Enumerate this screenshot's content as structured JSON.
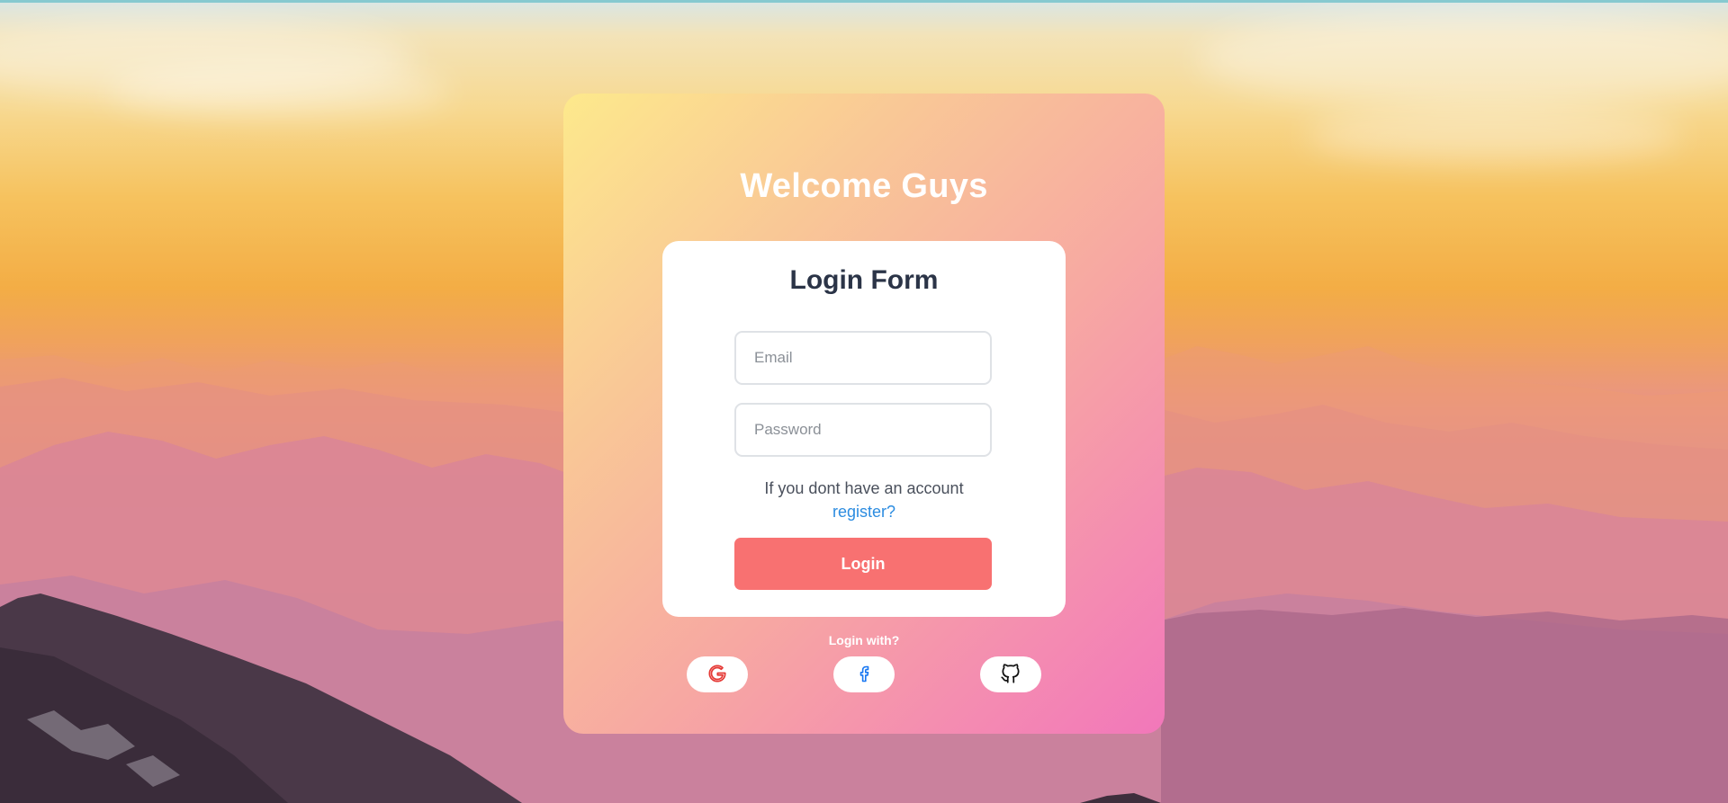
{
  "card": {
    "heading": "Welcome Guys"
  },
  "form": {
    "title": "Login Form",
    "email": {
      "placeholder": "Email",
      "value": ""
    },
    "password": {
      "placeholder": "Password",
      "value": ""
    },
    "account_prompt": "If you dont have an account",
    "register_link": "register?",
    "login_button": "Login"
  },
  "social": {
    "label": "Login with?",
    "providers": [
      {
        "name": "google",
        "icon": "google-icon"
      },
      {
        "name": "facebook",
        "icon": "facebook-icon"
      },
      {
        "name": "github",
        "icon": "github-icon"
      }
    ]
  },
  "colors": {
    "primary_button": "#f87171",
    "link": "#2c8ce0",
    "title_text": "#2b3447",
    "card_gradient_start": "#fde98c",
    "card_gradient_end": "#f277ba"
  }
}
